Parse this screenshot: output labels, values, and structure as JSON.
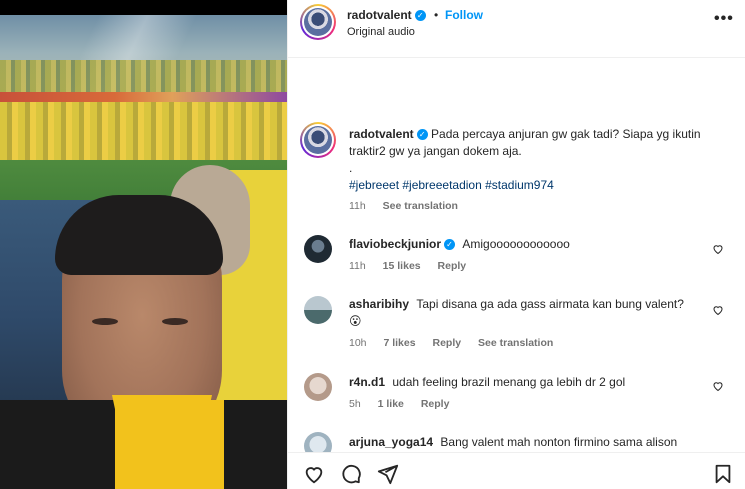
{
  "post": {
    "username": "radotvalent",
    "dot": "•",
    "follow_label": "Follow",
    "audio": "Original audio",
    "more": "•••"
  },
  "caption": {
    "username": "radotvalent",
    "text": "Pada percaya anjuran gw gak tadi? Siapa yg ikutin traktir2 gw ya jangan dokem aja.",
    "separator": ".",
    "hashtags": "#jebreeet #jebreeetadion #stadium974",
    "time": "11h",
    "see_translation": "See translation"
  },
  "comments": [
    {
      "username": "flaviobeckjunior",
      "verified": true,
      "text": "Amigoooooooooooo",
      "time": "11h",
      "likes": "15 likes",
      "reply": "Reply",
      "see_translation": ""
    },
    {
      "username": "asharibihy",
      "verified": false,
      "text": "Tapi disana ga ada gass airmata kan bung valent?",
      "emoji": "😮",
      "time": "10h",
      "likes": "7 likes",
      "reply": "Reply",
      "see_translation": "See translation"
    },
    {
      "username": "r4n.d1",
      "verified": false,
      "text": "udah feeling brazil menang ga lebih dr 2 gol",
      "time": "5h",
      "likes": "1 like",
      "reply": "Reply",
      "see_translation": ""
    },
    {
      "username": "arjuna_yoga14",
      "verified": false,
      "text": "Bang valent mah nonton firmino sama alison"
    }
  ],
  "icons": {
    "heart": "heart-icon",
    "comment": "comment-icon",
    "share": "share-icon",
    "save": "bookmark-icon",
    "verified": "verified-badge-icon",
    "more": "more-options-icon"
  },
  "colors": {
    "link": "#0095f6",
    "hashtag": "#00376b",
    "muted": "#737373",
    "verified": "#0095f6"
  }
}
